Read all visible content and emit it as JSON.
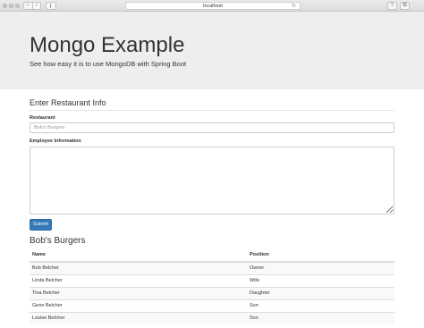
{
  "browser": {
    "address": "localhost",
    "back_glyph": "‹",
    "forward_glyph": "›",
    "reload_glyph": "↻",
    "share_glyph": "⇪",
    "tabs_glyph": "⧉"
  },
  "header": {
    "title": "Mongo Example",
    "subtitle": "See how easy it is to use MongoDB with Spring Boot"
  },
  "form": {
    "section_title": "Enter Restaurant Info",
    "restaurant_label": "Restaurant",
    "restaurant_placeholder": "Bob's Burgers",
    "employee_label": "Employee Information",
    "submit_label": "Submit"
  },
  "table": {
    "title": "Bob's Burgers",
    "columns": [
      "Name",
      "Position"
    ],
    "rows": [
      {
        "name": "Bob Belcher",
        "position": "Owner"
      },
      {
        "name": "Linda Belcher",
        "position": "Wife"
      },
      {
        "name": "Tina Belcher",
        "position": "Daughter"
      },
      {
        "name": "Gene Belcher",
        "position": "Son"
      },
      {
        "name": "Louise Belcher",
        "position": "Son"
      }
    ]
  },
  "colors": {
    "jumbotron_bg": "#eeeeee",
    "primary": "#337ab7",
    "text": "#333333"
  }
}
